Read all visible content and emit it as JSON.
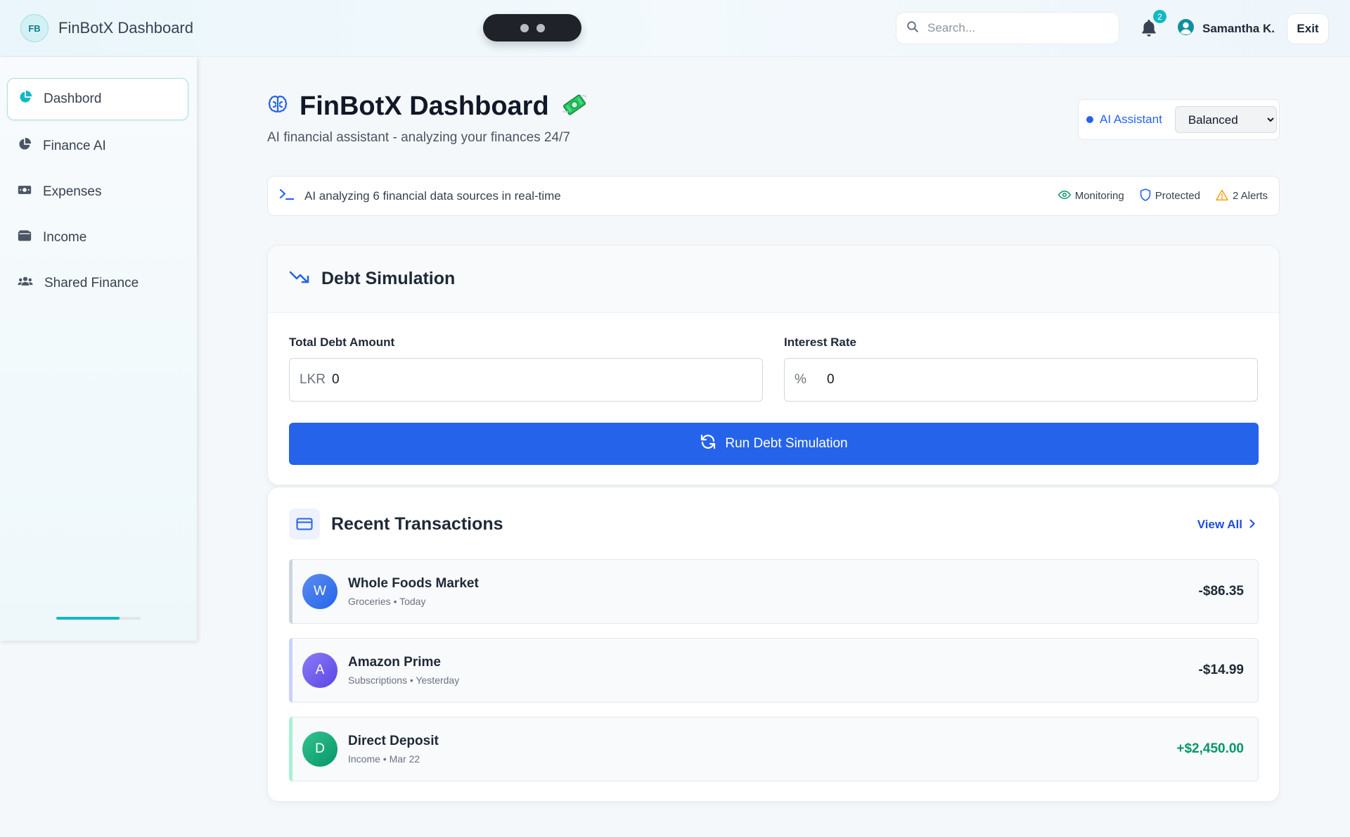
{
  "header": {
    "logo_initials": "FB",
    "app_title": "FinBotX Dashboard",
    "search_placeholder": "Search...",
    "notification_count": "2",
    "user_name": "Samantha K.",
    "exit_label": "Exit"
  },
  "sidebar": {
    "items": [
      {
        "label": "Dashbord",
        "icon": "pie-chart-icon",
        "active": true
      },
      {
        "label": "Finance AI",
        "icon": "pie-chart-icon",
        "active": false
      },
      {
        "label": "Expenses",
        "icon": "money-bill-icon",
        "active": false
      },
      {
        "label": "Income",
        "icon": "wallet-icon",
        "active": false
      },
      {
        "label": "Shared Finance",
        "icon": "users-icon",
        "active": false
      }
    ],
    "progress": 0.75
  },
  "page": {
    "title": "FinBotX Dashboard",
    "title_emoji": "money-with-wings-icon",
    "subtitle": "AI financial assistant - analyzing your finances 24/7",
    "ai_assistant_label": "AI Assistant",
    "ai_mode": "Balanced"
  },
  "status": {
    "text": "AI analyzing 6 financial data sources in real-time",
    "monitoring": "Monitoring",
    "protected": "Protected",
    "alerts": "2 Alerts"
  },
  "debt": {
    "title": "Debt Simulation",
    "total_label": "Total Debt Amount",
    "total_prefix": "LKR",
    "total_value": "0",
    "rate_label": "Interest Rate",
    "rate_prefix": "%",
    "rate_value": "0",
    "run_label": "Run Debt Simulation"
  },
  "transactions": {
    "title": "Recent Transactions",
    "view_all": "View All",
    "items": [
      {
        "initial": "W",
        "name": "Whole Foods Market",
        "meta": "Groceries • Today",
        "amount": "-$86.35"
      },
      {
        "initial": "A",
        "name": "Amazon Prime",
        "meta": "Subscriptions • Yesterday",
        "amount": "-$14.99"
      },
      {
        "initial": "D",
        "name": "Direct Deposit",
        "meta": "Income • Mar 22",
        "amount": "+$2,450.00"
      }
    ]
  },
  "colors": {
    "accent": "#14b8c4",
    "primary": "#2563eb",
    "positive": "#059669",
    "warning": "#f59e0b"
  }
}
